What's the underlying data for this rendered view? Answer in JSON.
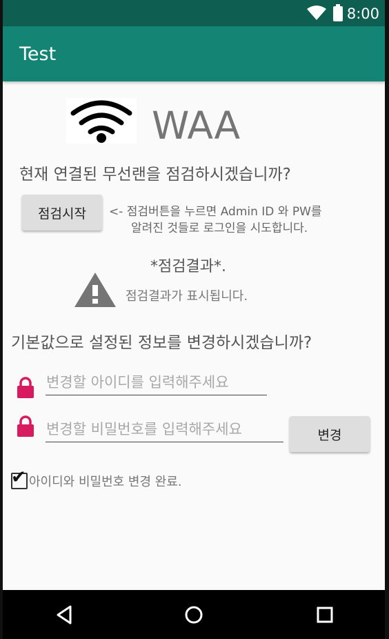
{
  "status_bar": {
    "time": "8:00"
  },
  "app_bar": {
    "title": "Test"
  },
  "header": {
    "app_name": "WAA"
  },
  "check_section": {
    "question": "현재 연결된 무선랜을 점검하시겠습니까?",
    "start_button": "점검시작",
    "hint_line1": "<- 점검버튼을 누르면 Admin ID 와 PW를",
    "hint_line2": "알려진 것들로 로그인을 시도합니다.",
    "result_title": "*점검결과*.",
    "result_text": "점검결과가 표시됩니다."
  },
  "change_section": {
    "question": "기본값으로 설정된 정보를 변경하시겠습니까?",
    "id_placeholder": "변경할 아이디를 입력해주세요",
    "id_value": "",
    "pw_placeholder": "변경할 비밀번호를 입력해주세요",
    "pw_value": "",
    "change_button": "변경",
    "complete_label": "아이디와 비밀번호 변경 완료.",
    "complete_checked": true
  },
  "colors": {
    "status_bar": "#0e5e52",
    "app_bar": "#148575",
    "lock_icon": "#d81b60",
    "warning_icon": "#757575"
  },
  "icons": {
    "wifi_logo": "wifi-icon",
    "warning": "warning-icon",
    "lock": "lock-icon",
    "nav_back": "back-triangle-icon",
    "nav_home": "home-circle-icon",
    "nav_recents": "recents-square-icon"
  }
}
